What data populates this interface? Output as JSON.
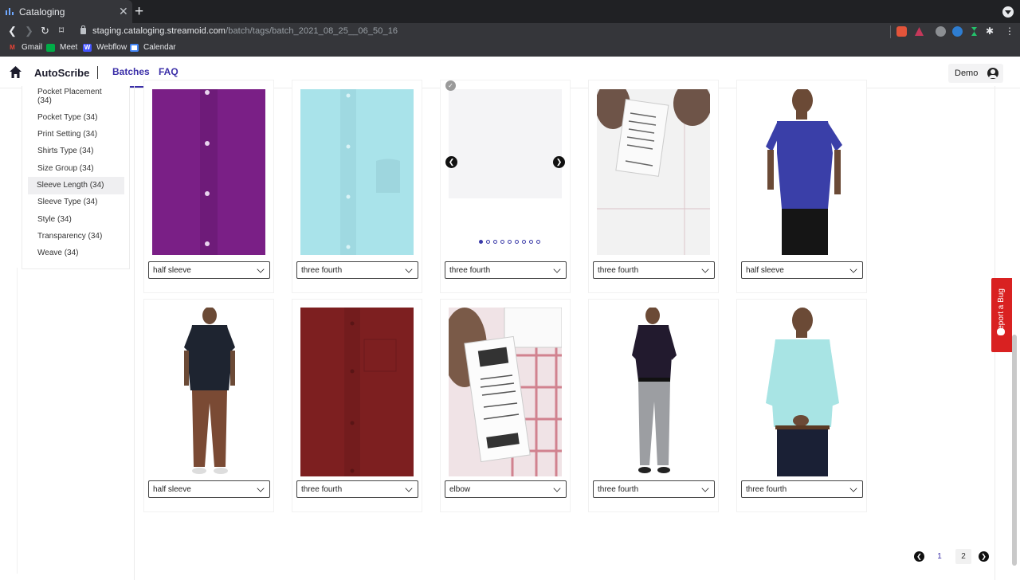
{
  "browser": {
    "tab_title": "Cataloging",
    "url_host": "staging.cataloging.streamoid.com",
    "url_path": "/batch/tags/batch_2021_08_25__06_50_16",
    "bookmarks": [
      {
        "label": "Gmail",
        "icon": "gmail-icon"
      },
      {
        "label": "Meet",
        "icon": "meet-icon"
      },
      {
        "label": "Webflow",
        "icon": "webflow-icon"
      },
      {
        "label": "Calendar",
        "icon": "calendar-icon"
      }
    ]
  },
  "app": {
    "brand": "AutoScribe",
    "nav": {
      "batches": "Batches",
      "faq": "FAQ"
    },
    "user": "Demo",
    "accent": "#3b2fa8"
  },
  "sidebar": {
    "items": [
      {
        "label": "Pocket Placement (34)"
      },
      {
        "label": "Pocket Type (34)"
      },
      {
        "label": "Print Setting (34)"
      },
      {
        "label": "Shirts Type (34)"
      },
      {
        "label": "Size Group (34)"
      },
      {
        "label": "Sleeve Length (34)",
        "active": true
      },
      {
        "label": "Sleeve Type (34)"
      },
      {
        "label": "Style (34)"
      },
      {
        "label": "Transparency (34)"
      },
      {
        "label": "Weave (34)"
      }
    ]
  },
  "cards": [
    {
      "value": "half sleeve",
      "image": "purple shirt closeup"
    },
    {
      "value": "three fourth",
      "image": "light blue shirt closeup"
    },
    {
      "value": "three fourth",
      "image": "white fabric carousel"
    },
    {
      "value": "three fourth",
      "image": "shirt label tag"
    },
    {
      "value": "half sleeve",
      "image": "model in blue half sleeve shirt"
    },
    {
      "value": "half sleeve",
      "image": "model in navy shirt and brown pants"
    },
    {
      "value": "three fourth",
      "image": "maroon shirt closeup"
    },
    {
      "value": "elbow",
      "image": "price tag on check shirt"
    },
    {
      "value": "three fourth",
      "image": "model in dark shirt grey pants"
    },
    {
      "value": "three fourth",
      "image": "model in light blue shirt"
    }
  ],
  "report_bug": "Report a Bug",
  "pagination": {
    "pages": [
      "1",
      "2"
    ],
    "current": "1"
  }
}
